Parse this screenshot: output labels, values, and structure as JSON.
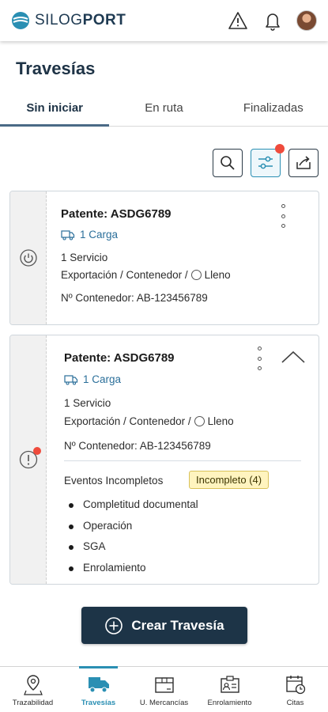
{
  "header": {
    "brand_light": "SILOG",
    "brand_bold": "PORT",
    "icons": [
      "warning-icon",
      "bell-icon",
      "avatar"
    ]
  },
  "page": {
    "title": "Travesías"
  },
  "tabs": [
    {
      "label": "Sin iniciar",
      "active": true
    },
    {
      "label": "En ruta",
      "active": false
    },
    {
      "label": "Finalizadas",
      "active": false
    }
  ],
  "toolbar": {
    "icons": [
      "search-icon",
      "filter-sliders-icon",
      "export-icon"
    ],
    "filter_has_notification": true
  },
  "cards": [
    {
      "patente": "Patente: ASDG6789",
      "carga": "1 Carga",
      "servicio": "1 Servicio",
      "detalle_prefix": "Exportación / Contenedor /",
      "estado": "Lleno",
      "contenedor": "Nº Contenedor: AB-123456789",
      "status_icon": "power-icon"
    },
    {
      "patente": "Patente: ASDG6789",
      "carga": "1 Carga",
      "servicio": "1 Servicio",
      "detalle_prefix": "Exportación / Contenedor /",
      "estado": "Lleno",
      "contenedor": "Nº Contenedor: AB-123456789",
      "status_icon": "alert-icon",
      "eventos_label": "Eventos Incompletos",
      "badge": "Incompleto (4)",
      "eventos": [
        "Completitud documental",
        "Operación",
        "SGA",
        "Enrolamiento"
      ]
    }
  ],
  "cta": {
    "label": "Crear Travesía"
  },
  "bottom_nav": [
    {
      "label": "Trazabilidad",
      "icon": "location-pin-icon",
      "active": false
    },
    {
      "label": "Travesías",
      "icon": "truck-icon",
      "active": true
    },
    {
      "label": "U. Mercancías",
      "icon": "box-icon",
      "active": false
    },
    {
      "label": "Enrolamiento",
      "icon": "id-card-icon",
      "active": false
    },
    {
      "label": "Citas",
      "icon": "calendar-clock-icon",
      "active": false
    }
  ],
  "colors": {
    "primary": "#1d3447",
    "accent": "#2a8fb3",
    "link": "#2b6f9a",
    "alert": "#ef4b3c",
    "badge_bg": "#fff4bf"
  }
}
